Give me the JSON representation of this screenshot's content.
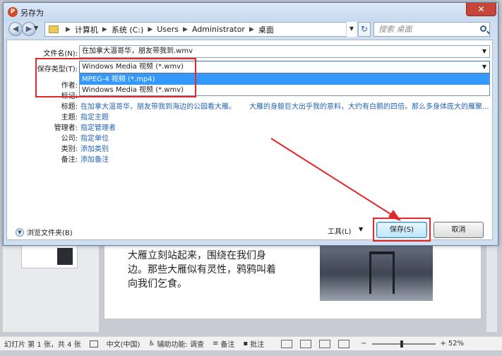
{
  "window": {
    "title": "另存为",
    "close_glyph": "✕",
    "app_icon_letter": "P"
  },
  "address": {
    "crumbs": [
      "计算机",
      "系统 (C:)",
      "Users",
      "Administrator",
      "桌面"
    ],
    "search_placeholder": "搜索 桌面"
  },
  "form": {
    "filename_label": "文件名(N):",
    "filename_value": "在加拿大温哥华，朋友带我到.wmv",
    "filetype_label": "保存类型(T):",
    "filetype_value": "Windows Media 视频 (*.wmv)",
    "filetype_options": [
      "MPEG-4 视频 (*.mp4)",
      "Windows Media 视频 (*.wmv)"
    ],
    "author_label": "作者:",
    "tags_label": "标记:",
    "title_label": "标题:",
    "title_value": "在加拿大温哥华，朋友带我到海边的公园看大雁。",
    "comment_value": "大雁的身躯巨大出乎我的意料，大约有白鹅的四倍。那么多身体庞大的雁聚...",
    "subject_label": "主题:",
    "subject_value": "指定主题",
    "manager_label": "管理者:",
    "manager_value": "指定管理者",
    "company_label": "公司:",
    "company_value": "指定单位",
    "category_label": "类别:",
    "category_value": "添加类别",
    "notes_label": "备注:",
    "notes_value": "添加备注"
  },
  "footer": {
    "browse_label": "浏览文件夹(B)",
    "tools_label": "工具(L)",
    "save_label": "保存(S)",
    "cancel_label": "取消"
  },
  "slide": {
    "text": "大雁立刻站起来，围绕在我们身边。那些大雁似有灵性，鸦鸦叫着向我们乞食。"
  },
  "statusbar": {
    "slide_info": "幻灯片 第 1 张，共 4 张",
    "language": "中文(中国)",
    "accessibility": "辅助功能: 调查",
    "notes": "备注",
    "comments": "批注",
    "zoom": "52%"
  },
  "colors": {
    "annotation": "#e3262c",
    "link": "#2463b5",
    "highlight": "#3399ff"
  }
}
